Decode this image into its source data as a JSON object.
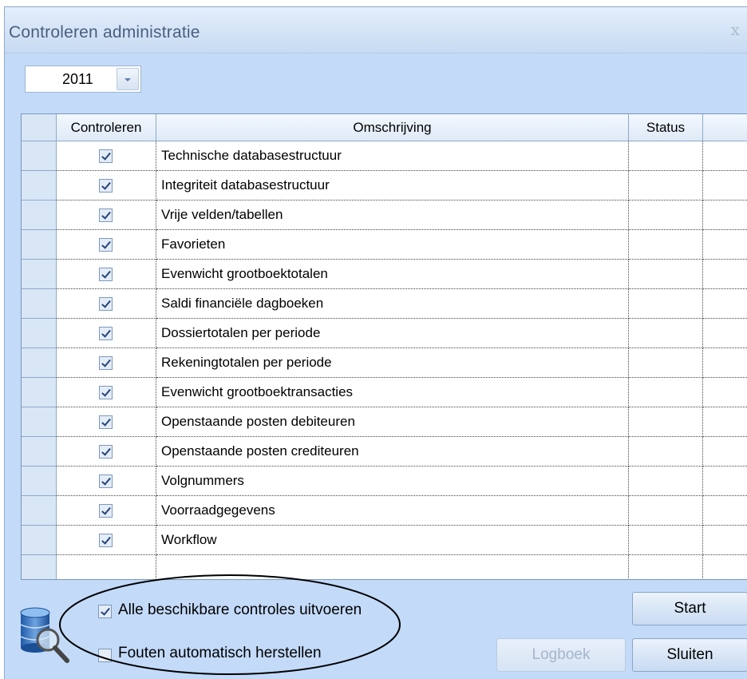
{
  "window": {
    "title": "Controleren administratie"
  },
  "year": {
    "value": "2011"
  },
  "table": {
    "columns": {
      "check": "Controleren",
      "description": "Omschrijving",
      "status": "Status"
    },
    "rows": [
      {
        "checked": true,
        "description": "Technische databasestructuur",
        "status": ""
      },
      {
        "checked": true,
        "description": "Integriteit databasestructuur",
        "status": ""
      },
      {
        "checked": true,
        "description": "Vrije velden/tabellen",
        "status": ""
      },
      {
        "checked": true,
        "description": "Favorieten",
        "status": ""
      },
      {
        "checked": true,
        "description": "Evenwicht grootboektotalen",
        "status": ""
      },
      {
        "checked": true,
        "description": "Saldi financiële dagboeken",
        "status": ""
      },
      {
        "checked": true,
        "description": "Dossiertotalen per periode",
        "status": ""
      },
      {
        "checked": true,
        "description": "Rekeningtotalen per periode",
        "status": ""
      },
      {
        "checked": true,
        "description": "Evenwicht grootboektransacties",
        "status": ""
      },
      {
        "checked": true,
        "description": "Openstaande posten debiteuren",
        "status": ""
      },
      {
        "checked": true,
        "description": "Openstaande posten crediteuren",
        "status": ""
      },
      {
        "checked": true,
        "description": "Volgnummers",
        "status": ""
      },
      {
        "checked": true,
        "description": "Voorraadgegevens",
        "status": ""
      },
      {
        "checked": true,
        "description": "Workflow",
        "status": ""
      }
    ]
  },
  "options": {
    "all_checks": {
      "label": "Alle beschikbare controles uitvoeren",
      "checked": true
    },
    "auto_fix": {
      "label": "Fouten automatisch herstellen",
      "checked": false
    }
  },
  "buttons": {
    "start": "Start",
    "log": "Logboek",
    "close": "Sluiten"
  },
  "icons": {
    "database_search": "database-search-icon",
    "close": "close-icon"
  }
}
